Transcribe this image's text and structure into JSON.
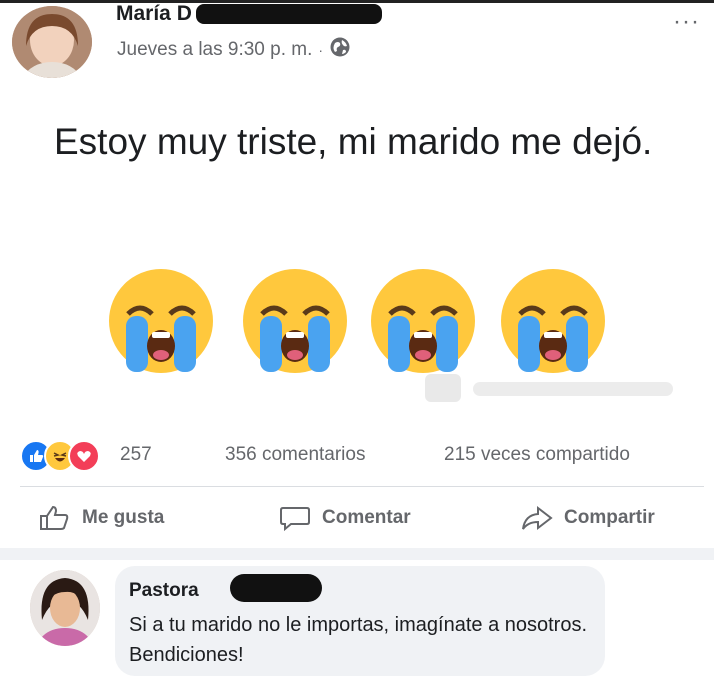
{
  "post": {
    "author_visible": "María D",
    "timestamp": "Jueves a las 9:30 p. m.",
    "separator": "·",
    "privacy_icon": "globe-icon",
    "more_icon": "more-options-icon",
    "more_label": "···",
    "text": "Estoy muy triste, mi marido me dejó.",
    "emojis": [
      "loudly-crying-face",
      "loudly-crying-face",
      "loudly-crying-face",
      "loudly-crying-face"
    ]
  },
  "stats": {
    "reaction_icons": [
      "like-icon",
      "haha-icon",
      "love-icon"
    ],
    "reaction_count": "257",
    "comments": "356 comentarios",
    "shares": "215 veces compartido"
  },
  "actions": {
    "like": "Me gusta",
    "comment": "Comentar",
    "share": "Compartir"
  },
  "comment": {
    "author_visible": "Pastora",
    "text": "Si a tu marido no le importas, imagínate a nosotros. Bendiciones!"
  },
  "colors": {
    "text_primary": "#1c1e21",
    "text_secondary": "#65676b",
    "like_blue": "#1877f2",
    "love_red": "#f33e58",
    "emoji_yellow": "#ffc83d",
    "tear_blue": "#4aa3f0",
    "bubble_bg": "#f0f2f5"
  }
}
